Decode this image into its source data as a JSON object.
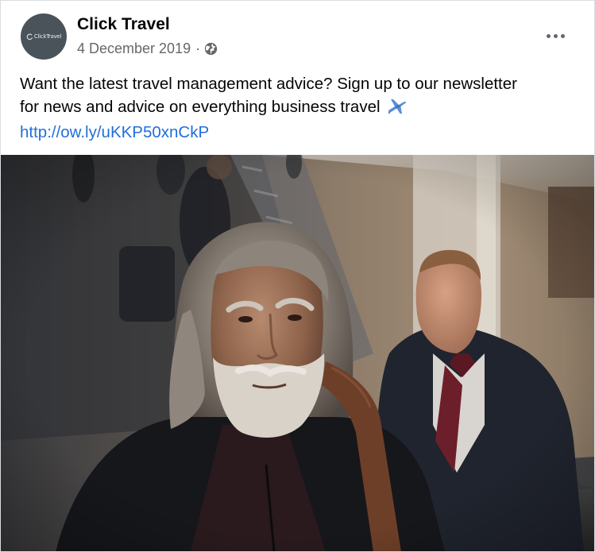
{
  "post": {
    "page_name": "Click Travel",
    "avatar_logo_text": "ClickTravel",
    "date": "4 December 2019",
    "separator": "·",
    "audience_icon": "globe-icon",
    "more_icon": "more-options-icon",
    "text_line_1": "Want the latest travel management advice? Sign up to our newsletter",
    "text_line_2": "for news and advice on everything business travel",
    "emoji_icon": "airplane-icon",
    "link": "http://ow.ly/uKKP50xnCkP",
    "image_description_icon": "photo-of-travellers-on-airport-escalator"
  },
  "colors": {
    "link": "#216fdb",
    "meta_text": "#65676b",
    "avatar_bg": "#4a535a",
    "plane": "#5b8fd6"
  }
}
